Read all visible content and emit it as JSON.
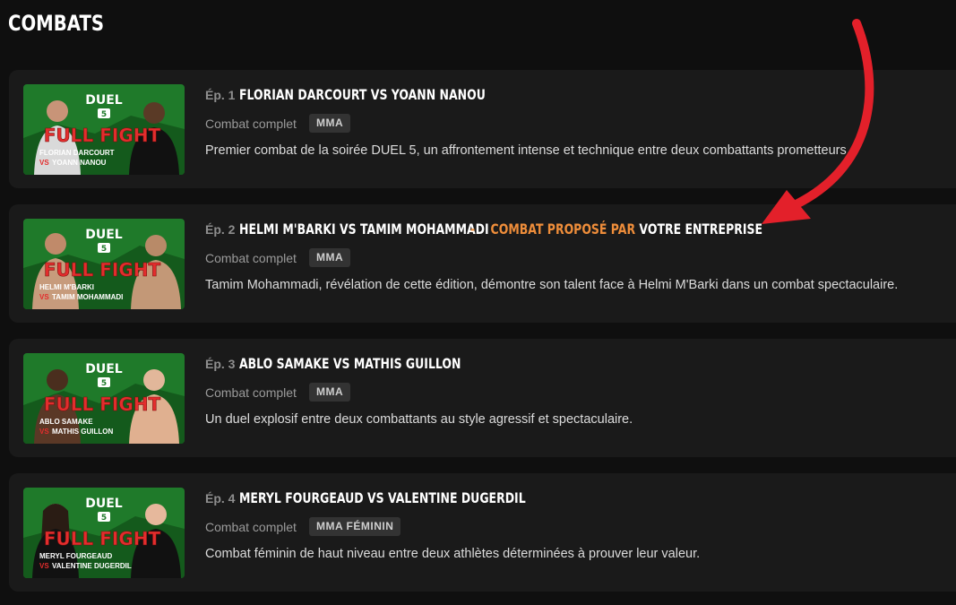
{
  "section": {
    "title": "COMBATS"
  },
  "episodes": [
    {
      "ep": "Ép. 1",
      "title": "FLORIAN DARCOURT VS YOANN NANOU",
      "type": "Combat complet",
      "badge": "MMA",
      "description": "Premier combat de la soirée DUEL 5, un affrontement intense et technique entre deux combattants prometteurs.",
      "thumb": {
        "brand": "DUEL",
        "num": "5",
        "banner": "FULL FIGHT",
        "fighter1": "FLORIAN DARCOURT",
        "vs": "VS",
        "fighter2": "YOANN NANOU"
      }
    },
    {
      "ep": "Ép. 2",
      "title": "HELMI M'BARKI VS TAMIM MOHAMMADI",
      "sponsor": {
        "dash": "-",
        "orange": "COMBAT PROPOSÉ PAR",
        "white": "VOTRE ENTREPRISE"
      },
      "type": "Combat complet",
      "badge": "MMA",
      "description": "Tamim Mohammadi, révélation de cette édition, démontre son talent face à Helmi M'Barki dans un combat spectaculaire.",
      "thumb": {
        "brand": "DUEL",
        "num": "5",
        "banner": "FULL FIGHT",
        "fighter1": "HELMI M'BARKI",
        "vs": "VS",
        "fighter2": "TAMIM MOHAMMADI"
      }
    },
    {
      "ep": "Ép. 3",
      "title": "ABLO SAMAKE VS MATHIS GUILLON",
      "type": "Combat complet",
      "badge": "MMA",
      "description": "Un duel explosif entre deux combattants au style agressif et spectaculaire.",
      "thumb": {
        "brand": "DUEL",
        "num": "5",
        "banner": "FULL FIGHT",
        "fighter1": "ABLO SAMAKE",
        "vs": "VS",
        "fighter2": "MATHIS GUILLON"
      }
    },
    {
      "ep": "Ép. 4",
      "title": "MERYL FOURGEAUD VS VALENTINE DUGERDIL",
      "type": "Combat complet",
      "badge": "MMA FÉMININ",
      "description": "Combat féminin de haut niveau entre deux athlètes déterminées à prouver leur valeur.",
      "thumb": {
        "brand": "DUEL",
        "num": "5",
        "banner": "FULL FIGHT",
        "fighter1": "MERYL FOURGEAUD",
        "vs": "VS",
        "fighter2": "VALENTINE DUGERDIL"
      }
    }
  ],
  "colors": {
    "accent_orange": "#ee8d3a",
    "arrow_red": "#e3202a",
    "thumb_green": "#1f7a2a",
    "banner_red": "#e32d2d"
  }
}
